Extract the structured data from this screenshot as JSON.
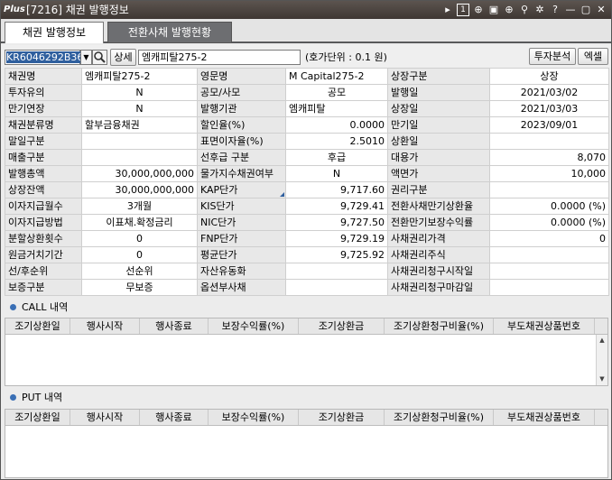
{
  "window": {
    "logo": "Plus",
    "title": "[7216] 채권 발행정보",
    "icons": [
      "pin-icon",
      "page-one-icon",
      "zoom-in-icon",
      "screenshot-icon",
      "search-zoom-icon",
      "thumbtack-icon",
      "settings-icon",
      "help-icon",
      "minimize-icon",
      "maximize-icon",
      "close-icon"
    ],
    "icon_glyphs": [
      "▸",
      "1",
      "⊕",
      "▣",
      "⊕",
      "⚲",
      "✲",
      "?",
      "—",
      "▢",
      "✕"
    ]
  },
  "tabs": [
    {
      "label": "채권 발행정보",
      "active": true
    },
    {
      "label": "전환사채 발행현황",
      "active": false
    }
  ],
  "toolbar": {
    "code": "KR6046292B36",
    "detail_button": "상세",
    "bond_name": "엠캐피탈275-2",
    "unit_text": "(호가단위 : 0.1  원)",
    "invest_analysis_button": "투자분석",
    "excel_button": "엑셀"
  },
  "info_rows": [
    [
      [
        "채권명",
        "lbl"
      ],
      [
        "엠캐피탈275-2",
        "l"
      ],
      [
        "영문명",
        "lbl"
      ],
      [
        "M Capital275-2",
        "l"
      ],
      [
        "상장구분",
        "lbl"
      ],
      [
        "상장",
        "c"
      ]
    ],
    [
      [
        "투자유의",
        "lbl"
      ],
      [
        "N",
        "c"
      ],
      [
        "공모/사모",
        "lbl"
      ],
      [
        "공모",
        "c"
      ],
      [
        "발행일",
        "lbl"
      ],
      [
        "2021/03/02",
        "c"
      ]
    ],
    [
      [
        "만기연장",
        "lbl"
      ],
      [
        "N",
        "c"
      ],
      [
        "발행기관",
        "lbl"
      ],
      [
        "엠캐피탈",
        "l"
      ],
      [
        "상장일",
        "lbl"
      ],
      [
        "2021/03/03",
        "c"
      ]
    ],
    [
      [
        "채권분류명",
        "lbl"
      ],
      [
        "할부금융채권",
        "l"
      ],
      [
        "할인율(%)",
        "lbl"
      ],
      [
        "0.0000",
        "r"
      ],
      [
        "만기일",
        "lbl"
      ],
      [
        "2023/09/01",
        "c"
      ]
    ],
    [
      [
        "말일구분",
        "lbl"
      ],
      [
        "",
        "c"
      ],
      [
        "표면이자율(%)",
        "lbl"
      ],
      [
        "2.5010",
        "r"
      ],
      [
        "상환일",
        "lbl"
      ],
      [
        "",
        "c"
      ]
    ],
    [
      [
        "매출구분",
        "lbl"
      ],
      [
        "",
        "c"
      ],
      [
        "선후급 구분",
        "lbl"
      ],
      [
        "후급",
        "c"
      ],
      [
        "대용가",
        "lbl"
      ],
      [
        "8,070",
        "r"
      ]
    ],
    [
      [
        "발행총액",
        "lbl"
      ],
      [
        "30,000,000,000",
        "r"
      ],
      [
        "물가지수채권여부",
        "lbl"
      ],
      [
        "N",
        "c"
      ],
      [
        "액면가",
        "lbl"
      ],
      [
        "10,000",
        "r"
      ]
    ],
    [
      [
        "상장잔액",
        "lbl"
      ],
      [
        "30,000,000,000",
        "r"
      ],
      [
        "KAP단가",
        "lbl tri"
      ],
      [
        "9,717.60",
        "r"
      ],
      [
        "권리구분",
        "lbl"
      ],
      [
        "",
        "c"
      ]
    ],
    [
      [
        "이자지급월수",
        "lbl"
      ],
      [
        "3개월",
        "c"
      ],
      [
        "KIS단가",
        "lbl"
      ],
      [
        "9,729.41",
        "r"
      ],
      [
        "전환사채만기상환율",
        "lbl"
      ],
      [
        "0.0000  (%)",
        "r"
      ]
    ],
    [
      [
        "이자지급방법",
        "lbl"
      ],
      [
        "이표채.확정금리",
        "c"
      ],
      [
        "NIC단가",
        "lbl"
      ],
      [
        "9,727.50",
        "r"
      ],
      [
        "전환만기보장수익률",
        "lbl"
      ],
      [
        "0.0000  (%)",
        "r"
      ]
    ],
    [
      [
        "분할상환횟수",
        "lbl"
      ],
      [
        "0",
        "c"
      ],
      [
        "FNP단가",
        "lbl"
      ],
      [
        "9,729.19",
        "r"
      ],
      [
        "사채권리가격",
        "lbl"
      ],
      [
        "0",
        "r"
      ]
    ],
    [
      [
        "원금거치기간",
        "lbl"
      ],
      [
        "0",
        "c"
      ],
      [
        "평균단가",
        "lbl"
      ],
      [
        "9,725.92",
        "r"
      ],
      [
        "사채권리주식",
        "lbl"
      ],
      [
        "",
        "c"
      ]
    ],
    [
      [
        "선/후순위",
        "lbl"
      ],
      [
        "선순위",
        "c"
      ],
      [
        "자산유동화",
        "lbl"
      ],
      [
        "",
        "c"
      ],
      [
        "사채권리청구시작일",
        "lbl"
      ],
      [
        "",
        "c"
      ]
    ],
    [
      [
        "보증구분",
        "lbl"
      ],
      [
        "무보증",
        "c"
      ],
      [
        "옵션부사채",
        "lbl"
      ],
      [
        "",
        "c"
      ],
      [
        "사채권리청구마감일",
        "lbl"
      ],
      [
        "",
        "c"
      ]
    ]
  ],
  "call": {
    "title": "CALL 내역",
    "columns": [
      "조기상환일",
      "행사시작",
      "행사종료",
      "보장수익률(%)",
      "조기상환금",
      "조기상환청구비율(%)",
      "부도채권상품번호"
    ]
  },
  "put": {
    "title": "PUT 내역",
    "columns": [
      "조기상환일",
      "행사시작",
      "행사종료",
      "보장수익률(%)",
      "조기상환금",
      "조기상환청구비율(%)",
      "부도채권상품번호"
    ]
  },
  "scroll_arrows": {
    "up": "▲",
    "down": "▼"
  }
}
